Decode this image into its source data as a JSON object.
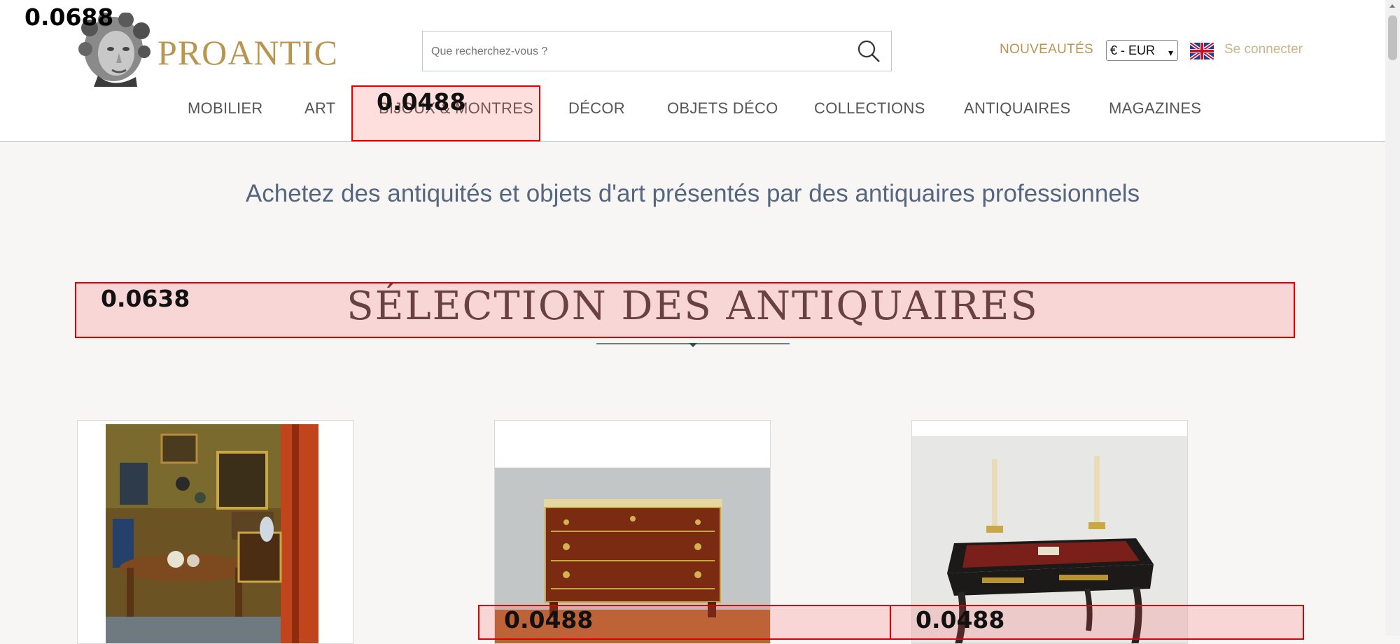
{
  "header": {
    "brand": "PROANTIC",
    "search": {
      "placeholder": "Que recherchez-vous ?",
      "value": ""
    },
    "nouveautes": "NOUVEAUTÉS",
    "currency": "€ - EUR",
    "language_flag": "uk-flag-icon",
    "login": "Se connecter"
  },
  "nav": {
    "items": [
      {
        "label": "MOBILIER"
      },
      {
        "label": "ART"
      },
      {
        "label": "BIJOUX & MONTRES"
      },
      {
        "label": "DÉCOR"
      },
      {
        "label": "OBJETS DÉCO"
      },
      {
        "label": "COLLECTIONS"
      },
      {
        "label": "ANTIQUAIRES"
      },
      {
        "label": "MAGAZINES"
      }
    ]
  },
  "main": {
    "tagline": "Achetez des antiquités et objets d'art présentés par des antiquaires professionnels",
    "section_title": "SÉLECTION DES ANTIQUAIRES",
    "cards": [
      {
        "image": "interior-painting"
      },
      {
        "image": "mahogany-commode"
      },
      {
        "image": "boulle-writing-desk"
      }
    ]
  },
  "overlays": {
    "corner_score": "0.0688",
    "nav_score": "0.0488",
    "section_score": "0.0638",
    "card2_score": "0.0488",
    "card3_score": "0.0488"
  },
  "colors": {
    "brand_gold": "#b8964f",
    "background": "#f7f6f5",
    "overlay_red": "#e00000"
  }
}
